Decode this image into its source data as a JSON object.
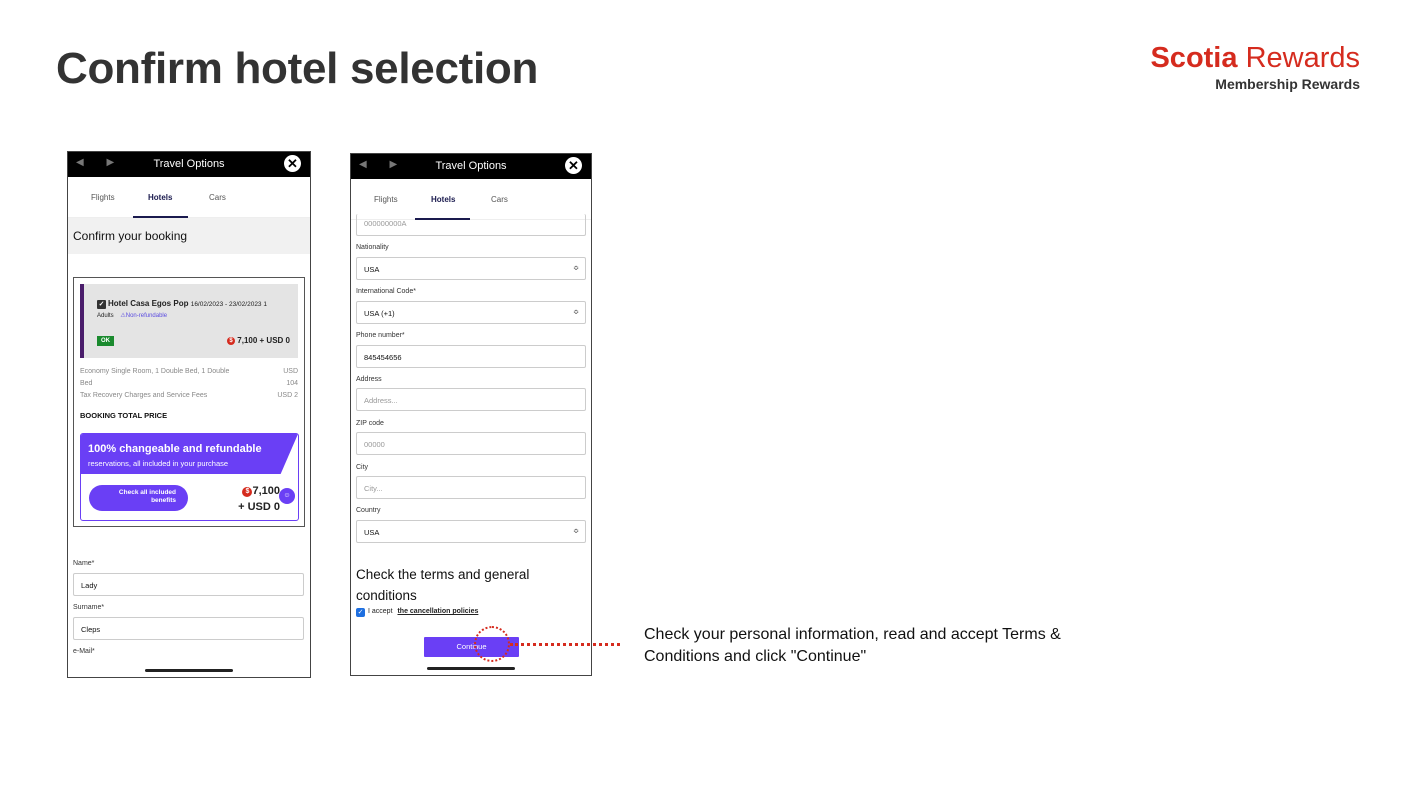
{
  "slide": {
    "title": "Confirm hotel selection",
    "brand_name_bold": "Scotia",
    "brand_name_light": "Rewards",
    "brand_subtitle": "Membership Rewards"
  },
  "app": {
    "window_title": "Travel Options",
    "close_glyph": "✕",
    "nav_glyphs": "◀ ▶",
    "tabs": [
      "Flights",
      "Hotels",
      "Cars"
    ],
    "active_tab": "Hotels"
  },
  "screen1": {
    "header": "Confirm your booking",
    "hotel": {
      "name": "Hotel Casa Egos Pop",
      "dates": "16/02/2023 - 23/02/2023 1",
      "adults": "Adults",
      "refund_note": "⚠Non-refundable",
      "status": "OK",
      "price": "7,100 + USD 0"
    },
    "line_items": [
      {
        "label": "Economy Single Room, 1 Double Bed, 1 Double",
        "value": "USD"
      },
      {
        "label": "Bed",
        "value": "104"
      },
      {
        "label": "Tax Recovery Charges and Service Fees",
        "value": "USD 2"
      }
    ],
    "total_label": "BOOKING TOTAL PRICE",
    "promo": {
      "title": "100% changeable and refundable",
      "subtitle": "reservations, all included in your purchase",
      "button_line1": "Check all included",
      "button_line2": "benefits",
      "points": "7,100",
      "usd": "+ USD 0"
    },
    "fields": {
      "name_label": "Name*",
      "name_value": "Lady",
      "surname_label": "Surname*",
      "surname_value": "Cleps",
      "email_label": "e-Mail*"
    }
  },
  "screen2": {
    "partial_field_value": "000000000A",
    "nationality_label": "Nationality",
    "nationality_value": "USA",
    "intl_code_label": "International Code*",
    "intl_code_value": "USA (+1)",
    "phone_label": "Phone number*",
    "phone_value": "845454656",
    "address_label": "Address",
    "address_placeholder": "Address...",
    "zip_label": "ZIP code",
    "zip_placeholder": "00000",
    "city_label": "City",
    "city_placeholder": "City...",
    "country_label": "Country",
    "country_value": "USA",
    "terms_title": "Check the terms and general conditions",
    "accept_text": "I accept",
    "policy_link": "the cancellation policies",
    "continue_label": "Continue",
    "select_caret": "≎",
    "check_glyph": "✓"
  },
  "callout": {
    "text": "Check your personal information, read and accept Terms & Conditions and click \"Continue\"",
    "color": "#d52b1e"
  },
  "colors": {
    "accent": "#6a3ff5",
    "brand": "#d52b1e",
    "ok_badge": "#1a8a2e",
    "nav_active": "#1a1a4e"
  }
}
